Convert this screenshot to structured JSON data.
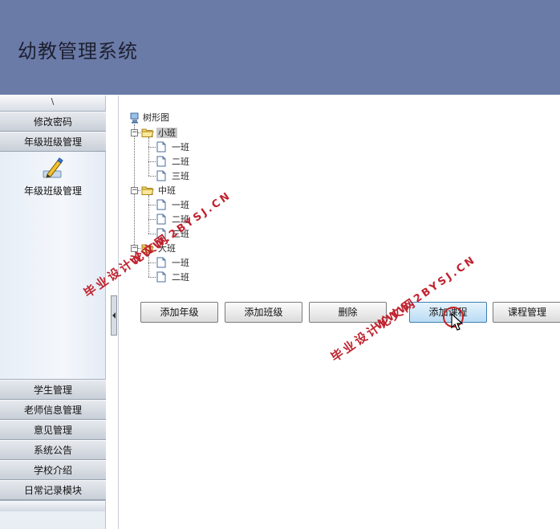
{
  "header": {
    "title": "幼教管理系统"
  },
  "sidebar": {
    "top_glyph": "\\",
    "buttons_top": [
      {
        "label": "修改密码"
      },
      {
        "label": "年级班级管理"
      }
    ],
    "panel_item": {
      "label": "年级班级管理",
      "icon": "pencil-icon"
    },
    "buttons_bottom": [
      {
        "label": "学生管理"
      },
      {
        "label": "老师信息管理"
      },
      {
        "label": "意见管理"
      },
      {
        "label": "系统公告"
      },
      {
        "label": "学校介绍"
      },
      {
        "label": "日常记录模块"
      }
    ]
  },
  "tree": {
    "root": "树形图",
    "grades": [
      {
        "label": "小班",
        "selected": true,
        "classes": [
          "一班",
          "二班",
          "三班"
        ]
      },
      {
        "label": "中班",
        "selected": false,
        "classes": [
          "一班",
          "二班",
          "三班"
        ]
      },
      {
        "label": "大班",
        "selected": false,
        "classes": [
          "一班",
          "二班"
        ]
      }
    ]
  },
  "actions": {
    "add_grade": "添加年级",
    "add_class": "添加班级",
    "delete": "删除",
    "add_course": "添加课程",
    "course_manage": "课程管理"
  },
  "watermarks": [
    {
      "url": "WWW.2BYSJ.CN",
      "site": "毕业设计论文网"
    },
    {
      "url": "WWW.2BYSJ.CN",
      "site": "毕业设计论文网"
    }
  ],
  "colors": {
    "header_bg": "#6b7ba8",
    "sidebar_bg": "#e9eef5",
    "watermark": "#c0232f"
  }
}
